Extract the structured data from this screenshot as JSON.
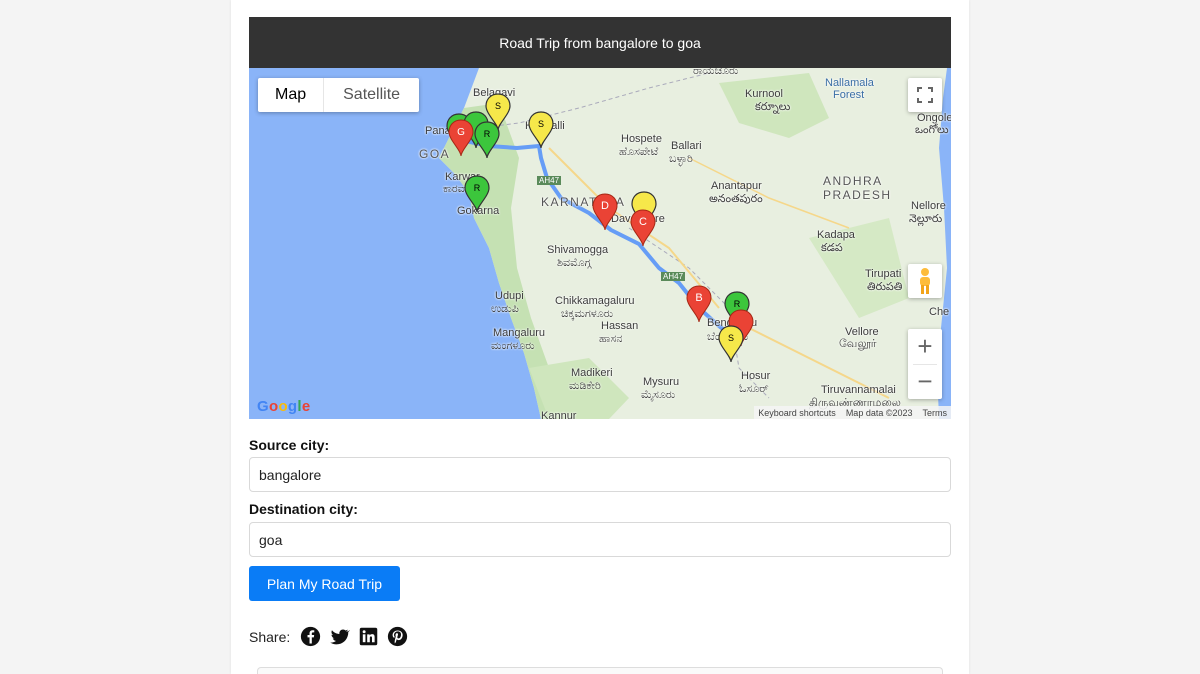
{
  "header": {
    "title": "Road Trip from bangalore to goa"
  },
  "map": {
    "type_buttons": {
      "map": "Map",
      "satellite": "Satellite"
    },
    "labels": {
      "goa": "GOA",
      "panaji": "Panaji",
      "belagavi": "Belagavi",
      "hubballi": "Hubballi",
      "hospete": "Hospete",
      "hospete_kn": "ಹೊಸಪೇಟೆ",
      "ballari": "Ballari",
      "ballari_kn": "ಬಳ್ಳಾರಿ",
      "karnataka": "KARNATAKA",
      "davangere": "Davangere",
      "karwar": "Karwar",
      "karwar_kn": "ಕಾರವಾರ",
      "gokarna": "Gokarna",
      "shivamogga": "Shivamogga",
      "shivamogga_kn": "ಶಿವಮೊಗ್ಗ",
      "udupi": "Udupi",
      "udupi_kn": "ಉಡುಪಿ",
      "chikkamagaluru": "Chikkamagaluru",
      "chikkamagaluru_kn": "ಚಿಕ್ಕಮಗಳೂರು",
      "hassan": "Hassan",
      "hassan_kn": "ಹಾಸನ",
      "mangaluru": "Mangaluru",
      "mangaluru_kn": "ಮಂಗಳೂರು",
      "madikeri": "Madikeri",
      "madikeri_kn": "ಮಡಿಕೇರಿ",
      "mysuru": "Mysuru",
      "mysuru_kn": "ಮೈಸೂರು",
      "kannur": "Kannur",
      "bengaluru": "Bengaluru",
      "bengaluru_kn": "ಬೆಂಗಳೂರು",
      "hosur": "Hosur",
      "hosur_kn": "ಓಸೂರ್",
      "kurnool": "Kurnool",
      "kurnool_te": "కర్నూలు",
      "nallamala": "Nallamala",
      "forest": "Forest",
      "raichur_kn": "ರಾಯಚೂರು",
      "anantapur": "Anantapur",
      "anantapur_te": "అనంతపురం",
      "andhra1": "ANDHRA",
      "andhra2": "PRADESH",
      "kadapa": "Kadapa",
      "kadapa_te": "కడప",
      "nellore": "Nellore",
      "nellore_te": "నెల్లూరు",
      "ongole": "Ongole",
      "ongole_te": "ఒంగోలు",
      "tirupati": "Tirupati",
      "tirupati_te": "తిరుపతి",
      "vellore": "Vellore",
      "vellore_ta": "வேலூர்",
      "tiruvannamalai": "Tiruvannamalai",
      "tiruvannamalai_ta": "திருவண்ணாமலை",
      "chennai": "Che",
      "ah47_1": "AH47",
      "ah47_2": "AH47"
    },
    "markers": {
      "goa_red": "G",
      "route_a": "R",
      "route_b": "R",
      "gokarna": "R",
      "belagavi_yellow": "S",
      "hubballi_yellow": "S",
      "davangere_red": "D",
      "davangere_c": "C",
      "davangere_yellow": "",
      "b_marker": "B",
      "bengaluru_green": "R",
      "bengaluru_yellow": "S"
    },
    "google_logo": "Google",
    "attribution": {
      "shortcuts": "Keyboard shortcuts",
      "data": "Map data ©2023",
      "terms": "Terms"
    },
    "zoom_in": "+",
    "zoom_out": "−"
  },
  "form": {
    "source_label": "Source city:",
    "source_value": "bangalore",
    "destination_label": "Destination city:",
    "destination_value": "goa",
    "submit_label": "Plan My Road Trip"
  },
  "share": {
    "label": "Share:",
    "icons": [
      "facebook-icon",
      "twitter-icon",
      "linkedin-icon",
      "pinterest-icon"
    ]
  }
}
